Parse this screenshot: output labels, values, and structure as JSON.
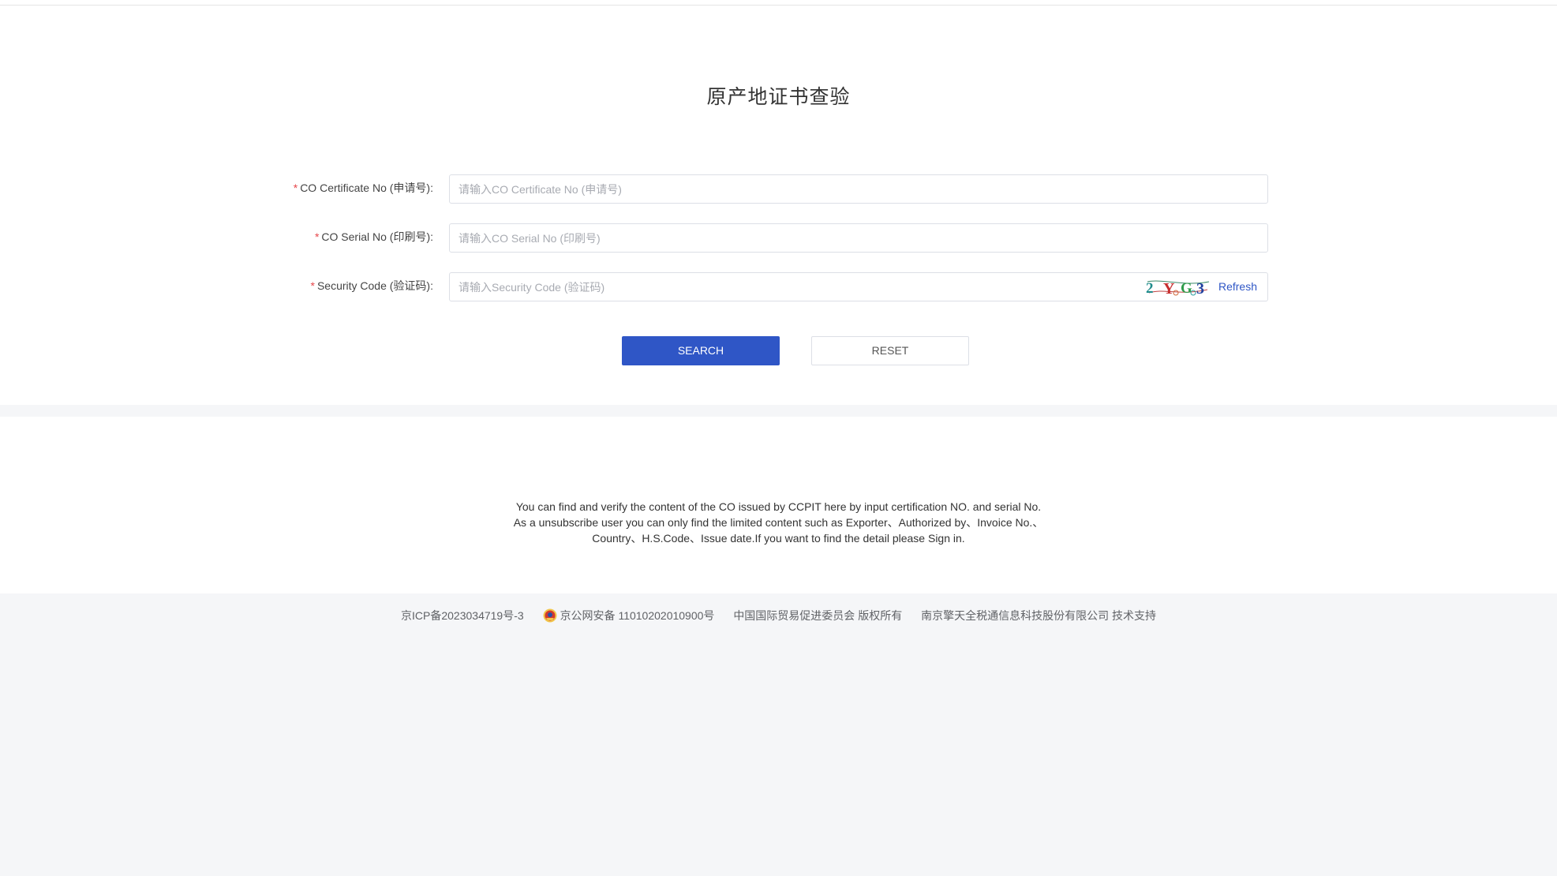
{
  "page": {
    "title": "原产地证书查验"
  },
  "form": {
    "certificate_no": {
      "required_mark": "*",
      "label": "CO Certificate No (申请号):",
      "value": "",
      "placeholder": "请输入CO Certificate No (申请号)"
    },
    "serial_no": {
      "required_mark": "*",
      "label": "CO Serial No (印刷号):",
      "value": "",
      "placeholder": "请输入CO Serial No (印刷号)"
    },
    "security_code": {
      "required_mark": "*",
      "label": "Security Code (验证码):",
      "value": "",
      "placeholder": "请输入Security Code (验证码)",
      "captcha_text": "2YG3",
      "refresh_label": "Refresh"
    },
    "search_label": "SEARCH",
    "reset_label": "RESET"
  },
  "info": {
    "lines": [
      "You can find and verify the content of the CO issued by CCPIT here by input certification NO. and serial No.",
      "As a unsubscribe user you can only find the limited content such as Exporter、Authorized by、Invoice No.、",
      "Country、H.S.Code、Issue date.If you want to find the detail please Sign in."
    ]
  },
  "footer": {
    "icp": "京ICP备2023034719号-3",
    "police_record": "京公网安备 11010202010900号",
    "copyright": "中国国际贸易促进委员会 版权所有",
    "tech_support": "南京擎天全税通信息科技股份有限公司 技术支持"
  },
  "colors": {
    "primary": "#2f56c6",
    "required": "#e6474b",
    "page_background": "#f5f6f8"
  },
  "icons": {
    "police_badge": "police-badge-icon"
  }
}
